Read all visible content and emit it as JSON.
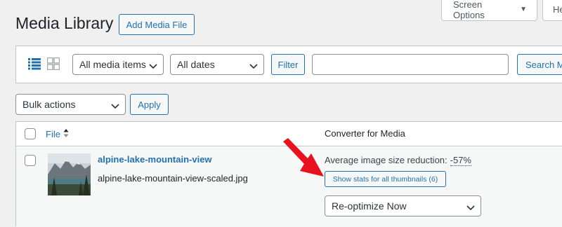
{
  "header": {
    "title": "Media Library",
    "add_button": "Add Media File",
    "screen_options": "Screen Options",
    "help": "He"
  },
  "filters": {
    "media_type": "All media items",
    "dates": "All dates",
    "filter_button": "Filter",
    "search_value": "",
    "search_button": "Search M"
  },
  "bulk": {
    "selected": "Bulk actions",
    "apply": "Apply"
  },
  "table": {
    "columns": [
      "File",
      "Converter for Media"
    ],
    "rows": [
      {
        "title": "alpine-lake-mountain-view",
        "file": "alpine-lake-mountain-view-scaled.jpg",
        "avg_label": "Average image size reduction:",
        "avg_value": "-57%",
        "stats_button": "Show stats for all thumbnails (6)",
        "action_select": "Re-optimize Now"
      }
    ]
  },
  "colors": {
    "accent": "#2271b1",
    "annotation_arrow": "#e8121f",
    "background": "#f0f0f1"
  },
  "icons": [
    "list-view-icon",
    "grid-view-icon",
    "chevron-down-icon",
    "sort-icon",
    "red-arrow-annotation"
  ]
}
